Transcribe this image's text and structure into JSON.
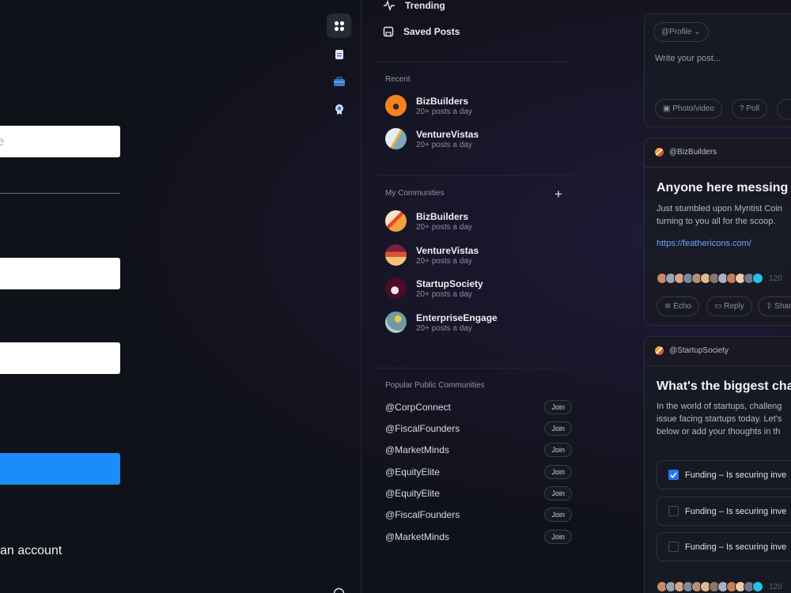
{
  "signin": {
    "input_placeholder": "le",
    "signup_text": "an account"
  },
  "nav": {
    "trending": "Trending",
    "saved_posts": "Saved Posts",
    "recent_title": "Recent",
    "recent": [
      {
        "name": "BizBuilders",
        "sub": "20+ posts a day"
      },
      {
        "name": "VentureVistas",
        "sub": "20+ posts a day"
      }
    ],
    "my_communities_title": "My Communities",
    "add_label": "+",
    "communities": [
      {
        "name": "BizBuilders",
        "sub": "20+ posts a day"
      },
      {
        "name": "VentureVistas",
        "sub": "20+ posts a day"
      },
      {
        "name": "StartupSociety",
        "sub": "20+ posts a day"
      },
      {
        "name": "EnterpriseEngage",
        "sub": "20+ posts a day"
      }
    ],
    "popular_title": "Popular Public Communities",
    "join_label": "Join",
    "popular": [
      "@CorpConnect",
      "@FiscalFounders",
      "@MarketMinds",
      "@EquityElite",
      "@EquityElite",
      "@FiscalFounders",
      "@MarketMinds"
    ]
  },
  "composer": {
    "profile_select": "@Profile",
    "placeholder": "Write your post...",
    "photo_video": "Photo/video",
    "poll": "Poll"
  },
  "post1": {
    "handle": "@BizBuilders",
    "title": "Anyone here messing",
    "body_line1": "Just stumbled upon Myntist Coin",
    "body_line2": "turning to you all for the scoop.",
    "link": "https://feathericons.com/",
    "count": "120",
    "echo": "Echo",
    "reply": "Reply",
    "share": "Shar"
  },
  "post2": {
    "handle": "@StartupSociety",
    "title": "What's the biggest cha",
    "body_line1": "In the world of startups, challeng",
    "body_line2": "issue facing startups today. Let's",
    "body_line3": "below or add your thoughts in th",
    "poll_options": [
      {
        "text": "Funding – Is securing inve",
        "checked": true
      },
      {
        "text": "Funding – Is securing inve",
        "checked": false
      },
      {
        "text": "Funding – Is securing inve",
        "checked": false
      }
    ],
    "count": "120"
  },
  "colors": {
    "background": "#10121a",
    "accent_blue": "#1c8cf8",
    "link_blue": "#6aa6ff"
  }
}
